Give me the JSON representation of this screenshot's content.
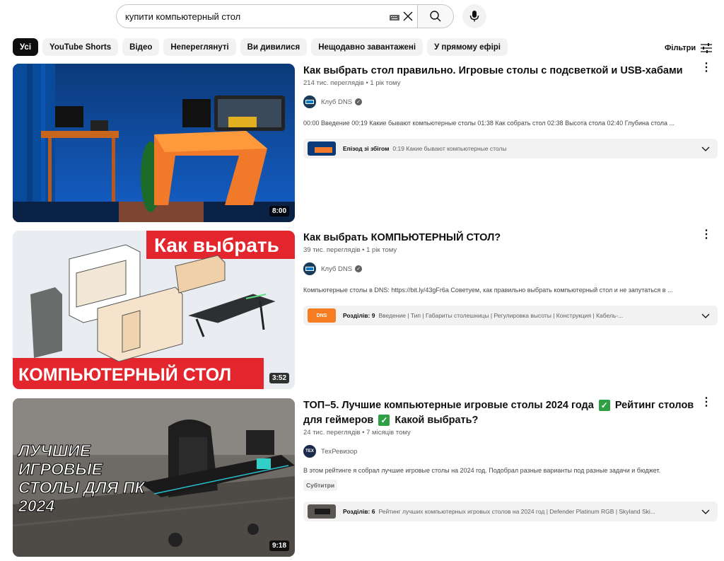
{
  "search": {
    "query": "купити компьютерный стол"
  },
  "chips": [
    "Усі",
    "YouTube Shorts",
    "Відео",
    "Непереглянуті",
    "Ви дивилися",
    "Нещодавно завантажені",
    "У прямому ефірі"
  ],
  "filters_label": "Фільтри",
  "results": [
    {
      "title": "Как выбрать стол правильно. Игровые столы с подсветкой и USB-хабами",
      "meta": "214 тис. переглядів • 1 рік тому",
      "channel": "Клуб DNS",
      "description": "00:00 Введение 00:19 Какие бывают компьютерные столы 01:38 Как собрать стол 02:38 Высота стола 02:40 Глубина стола ...",
      "duration": "8:00",
      "chapter_label": "Епізод зі збігом",
      "chapter_text": "0:19 Какие бывают компьютерные столы"
    },
    {
      "title": "Как выбрать КОМПЬЮТЕРНЫЙ СТОЛ?",
      "meta": "39 тис. переглядів • 1 рік тому",
      "channel": "Клуб DNS",
      "description": "Компьютерные столы в DNS: https://bit.ly/43gFr6a Советуем, как правильно выбрать компьютерный стол и не запутаться в ...",
      "duration": "3:52",
      "thumb_top": "Как выбрать",
      "thumb_bottom": "КОМПЬЮТЕРНЫЙ СТОЛ",
      "chapter_label": "Розділів: 9",
      "chapter_text": "Введение | Тип | Габариты столешницы | Регулировка высоты | Конструкция | Кабель-...",
      "chapter_thumb_text": "DNS"
    },
    {
      "title_line1": "ТОП–5. Лучшие компьютерные игровые столы 2024 года",
      "title_mid": "Рейтинг столов",
      "title_line2": "для геймеров",
      "title_end": "Какой выбрать?",
      "meta": "24 тис. переглядів • 7 місяців тому",
      "channel": "ТехРевизор",
      "channel_avatar_text": "ТЕХ",
      "description": "В этом рейтинге я собрал лучшие игровые столы на 2024 год. Подобрал разные варианты под разные задачи и бюджет.",
      "badge": "Субтитри",
      "duration": "9:18",
      "thumb_lines": [
        "ЛУЧШИЕ",
        "ИГРОВЫЕ",
        "СТОЛЫ ДЛЯ ПК",
        "2024"
      ],
      "chapter_label": "Розділів: 6",
      "chapter_text": "Рейтинг лучших компьютерных игровых столов на 2024 год | Defender Platinum RGB | Skyland Ski..."
    }
  ],
  "colors": {
    "accent_red": "#ff0000",
    "chip_bg": "#f2f2f2",
    "text_secondary": "#606060"
  }
}
